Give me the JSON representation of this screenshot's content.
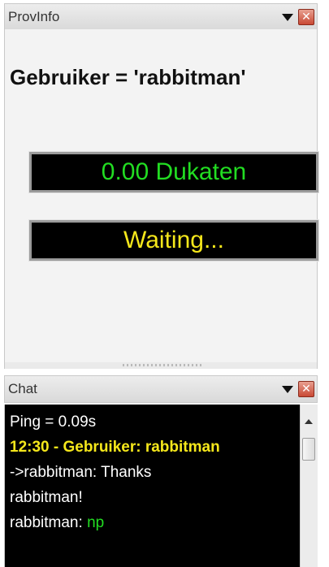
{
  "provinfo": {
    "title": "ProvInfo",
    "user_line": "Gebruiker = 'rabbitman'",
    "balance": "0.00 Dukaten",
    "status": "Waiting..."
  },
  "chat": {
    "title": "Chat",
    "lines": [
      {
        "text": "Ping = 0.09s"
      },
      {
        "text": "12:30 - Gebruiker: rabbitman"
      },
      {
        "text": "->rabbitman: Thanks"
      },
      {
        "text": "rabbitman!"
      },
      {
        "prefix": "rabbitman:",
        "message": "np"
      }
    ]
  },
  "icons": {
    "dropdown": "chevron-down-icon",
    "close": "close-icon",
    "close_glyph": "✕"
  },
  "colors": {
    "balance_text": "#22dd22",
    "status_text": "#f5e71b",
    "chat_self_text": "#f5e71b",
    "close_button": "#c94934"
  }
}
